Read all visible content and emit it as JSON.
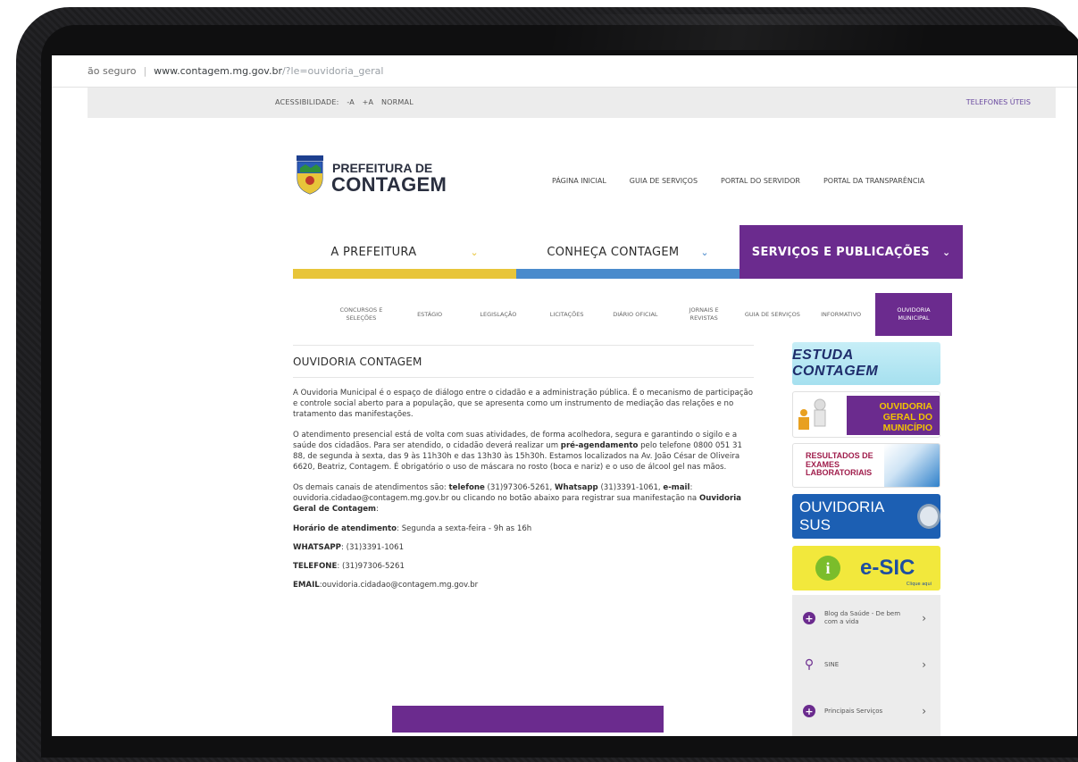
{
  "browser": {
    "security": "ão seguro",
    "domain": "www.contagem.mg.gov.br",
    "path": "/?le=ouvidoria_geral"
  },
  "accessibility": {
    "label": "ACESSIBILIDADE:",
    "decrease": "-A",
    "increase": "+A",
    "normal": "NORMAL",
    "phones": "TELEFONES ÚTEIS"
  },
  "logo": {
    "line1": "PREFEITURA DE",
    "line2": "CONTAGEM"
  },
  "topnav": [
    "PÁGINA INICIAL",
    "GUIA DE SERVIÇOS",
    "PORTAL DO SERVIDOR",
    "PORTAL DA TRANSPARÊNCIA"
  ],
  "mainnav": {
    "items": [
      {
        "label": "A PREFEITURA",
        "bar": "#e8c53a"
      },
      {
        "label": "CONHEÇA CONTAGEM",
        "bar": "#4a8bcc"
      },
      {
        "label": "SERVIÇOS E PUBLICAÇÕES",
        "bar": "#6b2b8e"
      }
    ],
    "chevron": "⌄"
  },
  "subnav": [
    "CONCURSOS E SELEÇÕES",
    "ESTÁGIO",
    "LEGISLAÇÃO",
    "LICITAÇÕES",
    "DIÁRIO OFICIAL",
    "JORNAIS E REVISTAS",
    "GUIA DE SERVIÇOS",
    "INFORMATIVO",
    "OUVIDORIA MUNICIPAL"
  ],
  "content": {
    "title": "OUVIDORIA CONTAGEM",
    "p1": "A Ouvidoria Municipal é o espaço de diálogo entre o cidadão e a administração pública. É o mecanismo de participação e controle social aberto para a população, que se apresenta como um instrumento de mediação das relações e no tratamento das manifestações.",
    "p2a": "O atendimento presencial está de volta com suas atividades, de forma acolhedora, segura e garantindo o sigilo e a saúde dos cidadãos. Para ser atendido, o cidadão deverá realizar um ",
    "p2b": "pré-agendamento",
    "p2c": " pelo telefone 0800 051 31 88, de segunda à sexta, das 9 às 11h30h e das 13h30 às 15h30h. Estamos localizados na Av. João César de Oliveira 6620, Beatriz, Contagem. É obrigatório o uso de máscara no rosto (boca e nariz) e o uso de álcool gel nas mãos.",
    "p3a": "Os demais canais de atendimentos são: ",
    "p3b": "telefone",
    "p3c": " (31)97306-5261, ",
    "p3d": "Whatsapp",
    "p3e": " (31)3391-1061, ",
    "p3f": "e-mail",
    "p3g": ": ouvidoria.cidadao@contagem.mg.gov.br ou clicando no botão abaixo para registrar sua manifestação na ",
    "p3h": "Ouvidoria Geral de Contagem",
    "p3i": ":",
    "hours_label": "Horário de atendimento",
    "hours_value": ": Segunda a sexta-feira - 9h as 16h",
    "whatsapp_label": "WHATSAPP",
    "whatsapp_value": ": (31)3391-1061",
    "phone_label": "TELEFONE",
    "phone_value": ": (31)97306-5261",
    "email_label": "EMAIL",
    "email_value": ":ouvidoria.cidadao@contagem.mg.gov.br"
  },
  "banners": {
    "estuda": "ESTUDA CONTAGEM",
    "ouvidoria": "OUVIDORIA GERAL DO MUNICÍPIO",
    "resultados": "RESULTADOS DE EXAMES LABORATORIAIS",
    "sus": "OUVIDORIA SUS",
    "esic": "e-SIC",
    "esic_sub": "Clique aqui"
  },
  "sidelist": [
    {
      "label": "Blog da Saúde - De bem com a vida",
      "icon": "plus-icon"
    },
    {
      "label": "SINE",
      "icon": "search-icon"
    },
    {
      "label": "Principais Serviços",
      "icon": "plus-icon"
    }
  ],
  "colors": {
    "purple": "#6b2b8e",
    "yellow": "#e8c53a",
    "blue": "#4a8bcc"
  }
}
